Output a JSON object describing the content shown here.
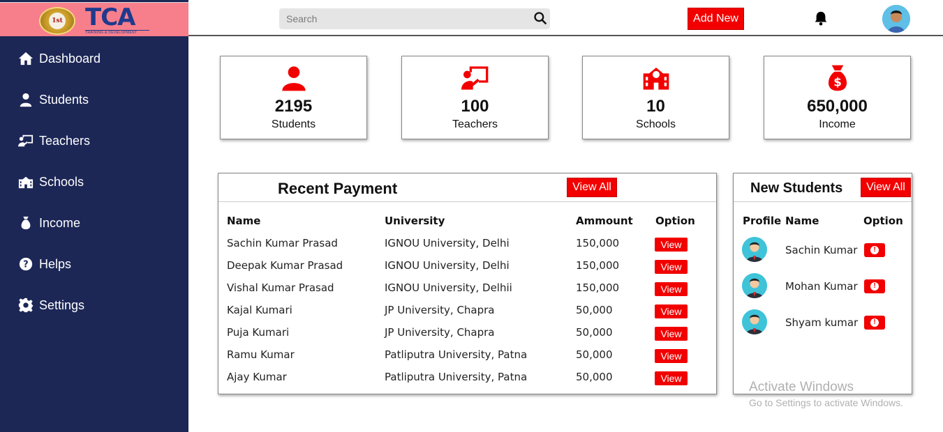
{
  "brand": {
    "logo_text": "TCA",
    "tagline": "TRAINING & DEVELOPMENT",
    "medal_text": "1st"
  },
  "sidebar": {
    "items": [
      {
        "label": "Dashboard",
        "icon": "home-icon"
      },
      {
        "label": "Students",
        "icon": "user-icon"
      },
      {
        "label": "Teachers",
        "icon": "chalkboard-teacher-icon"
      },
      {
        "label": "Schools",
        "icon": "school-icon"
      },
      {
        "label": "Income",
        "icon": "money-bag-icon"
      },
      {
        "label": "Helps",
        "icon": "question-icon"
      },
      {
        "label": "Settings",
        "icon": "gear-icon"
      }
    ]
  },
  "topbar": {
    "search_placeholder": "Search",
    "add_new_label": "Add New"
  },
  "stats": [
    {
      "value": "2195",
      "label": "Students",
      "icon": "user-icon"
    },
    {
      "value": "100",
      "label": "Teachers",
      "icon": "chalkboard-teacher-icon"
    },
    {
      "value": "10",
      "label": "Schools",
      "icon": "school-icon"
    },
    {
      "value": "650,000",
      "label": "Income",
      "icon": "money-bag-icon"
    }
  ],
  "recent_payment": {
    "title": "Recent Payment",
    "view_all_label": "View All",
    "columns": [
      "Name",
      "University",
      "Ammount",
      "Option"
    ],
    "rows": [
      {
        "name": "Sachin Kumar Prasad",
        "university": "IGNOU University, Delhi",
        "amount": "150,000",
        "option": "View"
      },
      {
        "name": "Deepak Kumar Prasad",
        "university": "IGNOU University, Delhi",
        "amount": "150,000",
        "option": "View"
      },
      {
        "name": "Vishal Kumar Prasad",
        "university": "IGNOU University, Delhii",
        "amount": "150,000",
        "option": "View"
      },
      {
        "name": "Kajal Kumari",
        "university": "JP University, Chapra",
        "amount": "50,000",
        "option": "View"
      },
      {
        "name": "Puja Kumari",
        "university": "JP University, Chapra",
        "amount": "50,000",
        "option": "View"
      },
      {
        "name": "Ramu Kumar",
        "university": "Patliputra University, Patna",
        "amount": "50,000",
        "option": "View"
      },
      {
        "name": "Ajay Kumar",
        "university": "Patliputra University, Patna",
        "amount": "50,000",
        "option": "View"
      }
    ]
  },
  "new_students": {
    "title": "New Students",
    "view_all_label": "View All",
    "columns": [
      "Profile",
      "Name",
      "Option"
    ],
    "rows": [
      {
        "name": "Sachin Kumar",
        "option_icon": "alert-icon"
      },
      {
        "name": "Mohan Kumar",
        "option_icon": "alert-icon"
      },
      {
        "name": "Shyam kumar",
        "option_icon": "alert-icon"
      }
    ]
  },
  "watermark": {
    "line1": "Activate Windows",
    "line2": "Go to Settings to activate Windows."
  },
  "colors": {
    "sidebar": "#1c2756",
    "logo_bar": "#f77f8c",
    "accent": "#f20000"
  }
}
